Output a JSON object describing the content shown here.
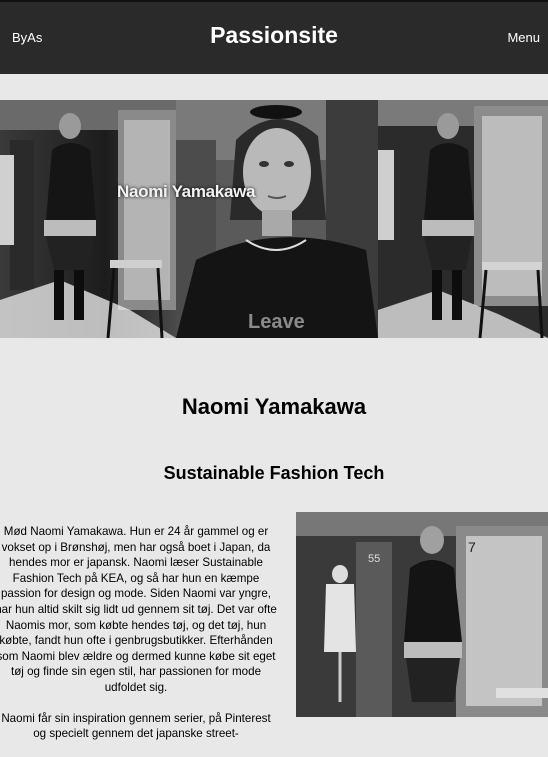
{
  "header": {
    "brand": "ByAs",
    "title": "Passionsite",
    "menu_label": "Menu"
  },
  "hero": {
    "overlay_name": "Naomi Yamakawa"
  },
  "main": {
    "name_heading": "Naomi Yamakawa",
    "program_heading": "Sustainable Fashion Tech",
    "bio_paragraphs": [
      "Mød Naomi Yamakawa. Hun er 24 år gammel og er vokset op i Brønshøj, men har også boet i Japan, da hendes mor er japansk. Naomi læser Sustainable Fashion Tech på KEA, og så har hun en kæmpe passion for design og mode. Siden Naomi var yngre, har hun altid skilt sig lidt ud gennem sit tøj. Det var ofte Naomis mor, som købte hendes tøj, og det tøj, hun købte, fandt hun ofte i genbrugsbutikker. Efterhånden som Naomi blev ældre og dermed kunne købe sit eget tøj og finde sin egen stil, har passionen for mode udfoldet sig.",
      "Naomi får sin inspiration gennem serier, på Pinterest og specielt gennem det japanske street-"
    ]
  },
  "colors": {
    "header_bg": "#2a2a2a",
    "page_bg": "#e8e8e8"
  }
}
